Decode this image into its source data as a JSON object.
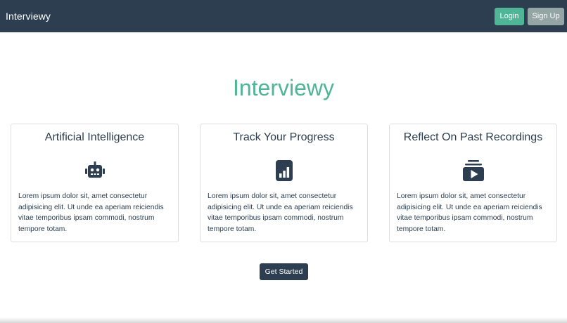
{
  "navbar": {
    "brand": "Interviewy",
    "login_label": "Login",
    "signup_label": "Sign Up"
  },
  "hero": {
    "title": "Interviewy"
  },
  "features": [
    {
      "title": "Artificial Intelligence",
      "icon": "robot-icon",
      "text": "Lorem ipsum dolor sit, amet consectetur adipisicing elit. Ut unde ea aperiam reiciendis vitae temporibus ipsam commodi, nostrum tempore totam."
    },
    {
      "title": "Track Your Progress",
      "icon": "chart-icon",
      "text": "Lorem ipsum dolor sit, amet consectetur adipisicing elit. Ut unde ea aperiam reiciendis vitae temporibus ipsam commodi, nostrum tempore totam."
    },
    {
      "title": "Reflect On Past Recordings",
      "icon": "video-playlist-icon",
      "text": "Lorem ipsum dolor sit, amet consectetur adipisicing elit. Ut unde ea aperiam reiciendis vitae temporibus ipsam commodi, nostrum tempore totam."
    }
  ],
  "cta": {
    "label": "Get Started"
  },
  "colors": {
    "navbar": "#2c3e50",
    "accent": "#4fb596",
    "secondary": "#95a5a6"
  }
}
